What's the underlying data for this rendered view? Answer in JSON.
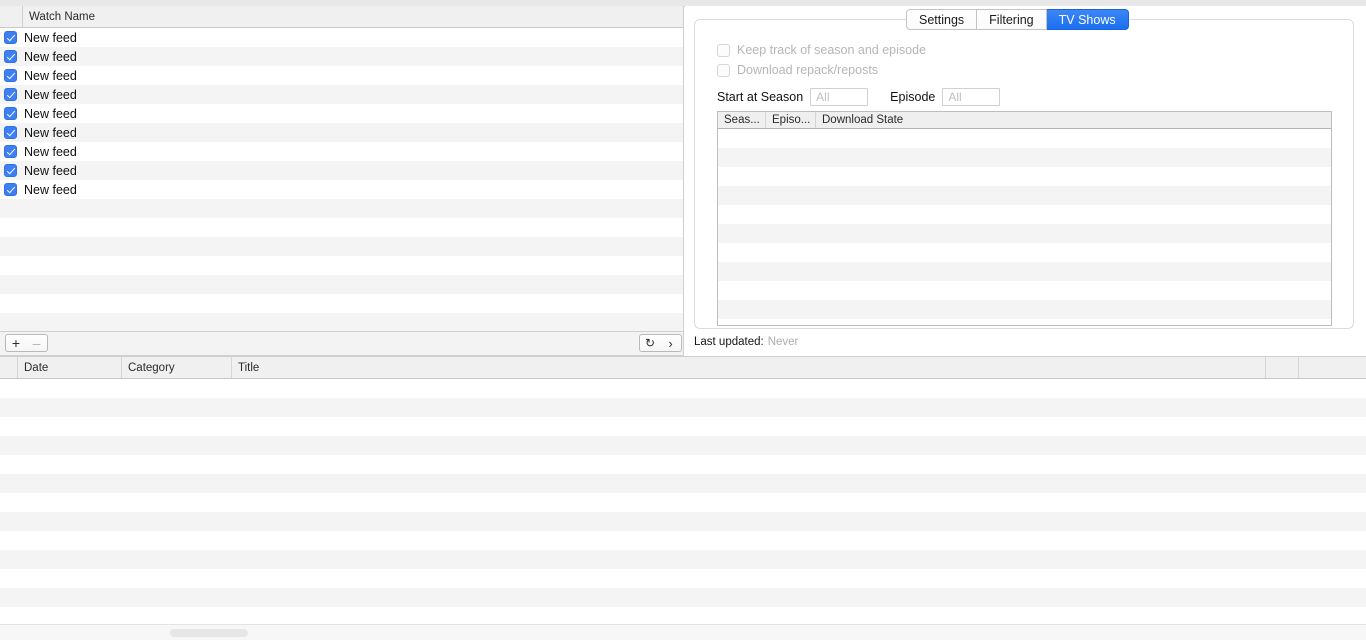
{
  "watch_list": {
    "columns": [
      "",
      "Watch Name"
    ],
    "header_name_label": "Watch Name",
    "rows": [
      {
        "checked": true,
        "name": "New feed"
      },
      {
        "checked": true,
        "name": "New feed"
      },
      {
        "checked": true,
        "name": "New feed"
      },
      {
        "checked": true,
        "name": "New feed"
      },
      {
        "checked": true,
        "name": "New feed"
      },
      {
        "checked": true,
        "name": "New feed"
      },
      {
        "checked": true,
        "name": "New feed"
      },
      {
        "checked": true,
        "name": "New feed"
      },
      {
        "checked": true,
        "name": "New feed"
      }
    ],
    "empty_rows": 7
  },
  "watch_toolbar": {
    "add_label": "+",
    "remove_label": "–",
    "remove_enabled": false,
    "refresh_icon": "↻",
    "next_icon": "›"
  },
  "detail": {
    "tabs": [
      {
        "label": "Settings",
        "active": false
      },
      {
        "label": "Filtering",
        "active": false
      },
      {
        "label": "TV Shows",
        "active": true
      }
    ],
    "tv_shows": {
      "checkboxes": [
        {
          "label": "Keep track of season and episode",
          "checked": false,
          "enabled": false
        },
        {
          "label": "Download repack/reposts",
          "checked": false,
          "enabled": false
        }
      ],
      "season_label": "Start at Season",
      "season_value": "",
      "season_placeholder": "All",
      "episode_label": "Episode",
      "episode_value": "",
      "episode_placeholder": "All",
      "table": {
        "columns": [
          "Seas...",
          "Episo...",
          "Download State"
        ],
        "rows": [],
        "empty_rows": 11
      }
    },
    "last_updated_label": "Last updated:",
    "last_updated_value": "Never"
  },
  "results": {
    "columns": [
      "",
      "Date",
      "Category",
      "Title",
      "",
      ""
    ],
    "rows": [],
    "empty_rows": 13
  },
  "colors": {
    "accent": "#1a6ff0",
    "checkbox_on": "#3d7ff5",
    "row_alt": "#f4f4f4",
    "header_bg": "#f0f0f0",
    "disabled_text": "#b6b6b6"
  }
}
